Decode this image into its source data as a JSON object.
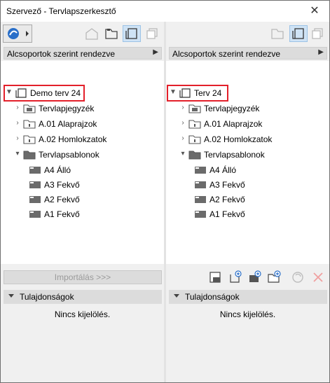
{
  "window": {
    "title": "Szervező - Tervlapszerkesztő",
    "close_glyph": "✕"
  },
  "left": {
    "sort_label": "Alcsoportok szerint rendezve",
    "project_name": "Demo terv 24",
    "tree": [
      {
        "label": "Tervlapjegyzék",
        "icon": "index-folder-icon"
      },
      {
        "label": "A.01 Alaprajzok",
        "icon": "folder-icon"
      },
      {
        "label": "A.02 Homlokzatok",
        "icon": "folder-icon"
      },
      {
        "label": "Tervlapsablonok",
        "icon": "master-folder-icon"
      }
    ],
    "masters": [
      "A4 Álló",
      "A3 Fekvő",
      "A2 Fekvő",
      "A1 Fekvő"
    ],
    "import_label": "Importálás >>>",
    "props_label": "Tulajdonságok",
    "no_selection": "Nincs kijelölés."
  },
  "right": {
    "sort_label": "Alcsoportok szerint rendezve",
    "project_name": "Terv 24",
    "tree": [
      {
        "label": "Tervlapjegyzék",
        "icon": "index-folder-icon"
      },
      {
        "label": "A.01 Alaprajzok",
        "icon": "folder-icon"
      },
      {
        "label": "A.02 Homlokzatok",
        "icon": "folder-icon"
      },
      {
        "label": "Tervlapsablonok",
        "icon": "master-folder-icon"
      }
    ],
    "masters": [
      "A4 Álló",
      "A3 Fekvő",
      "A2 Fekvő",
      "A1 Fekvő"
    ],
    "props_label": "Tulajdonságok",
    "no_selection": "Nincs kijelölés."
  },
  "colors": {
    "highlight": "#e3202a",
    "active_tool": "#cfe3f5",
    "panel_header": "#dcdcdc"
  }
}
